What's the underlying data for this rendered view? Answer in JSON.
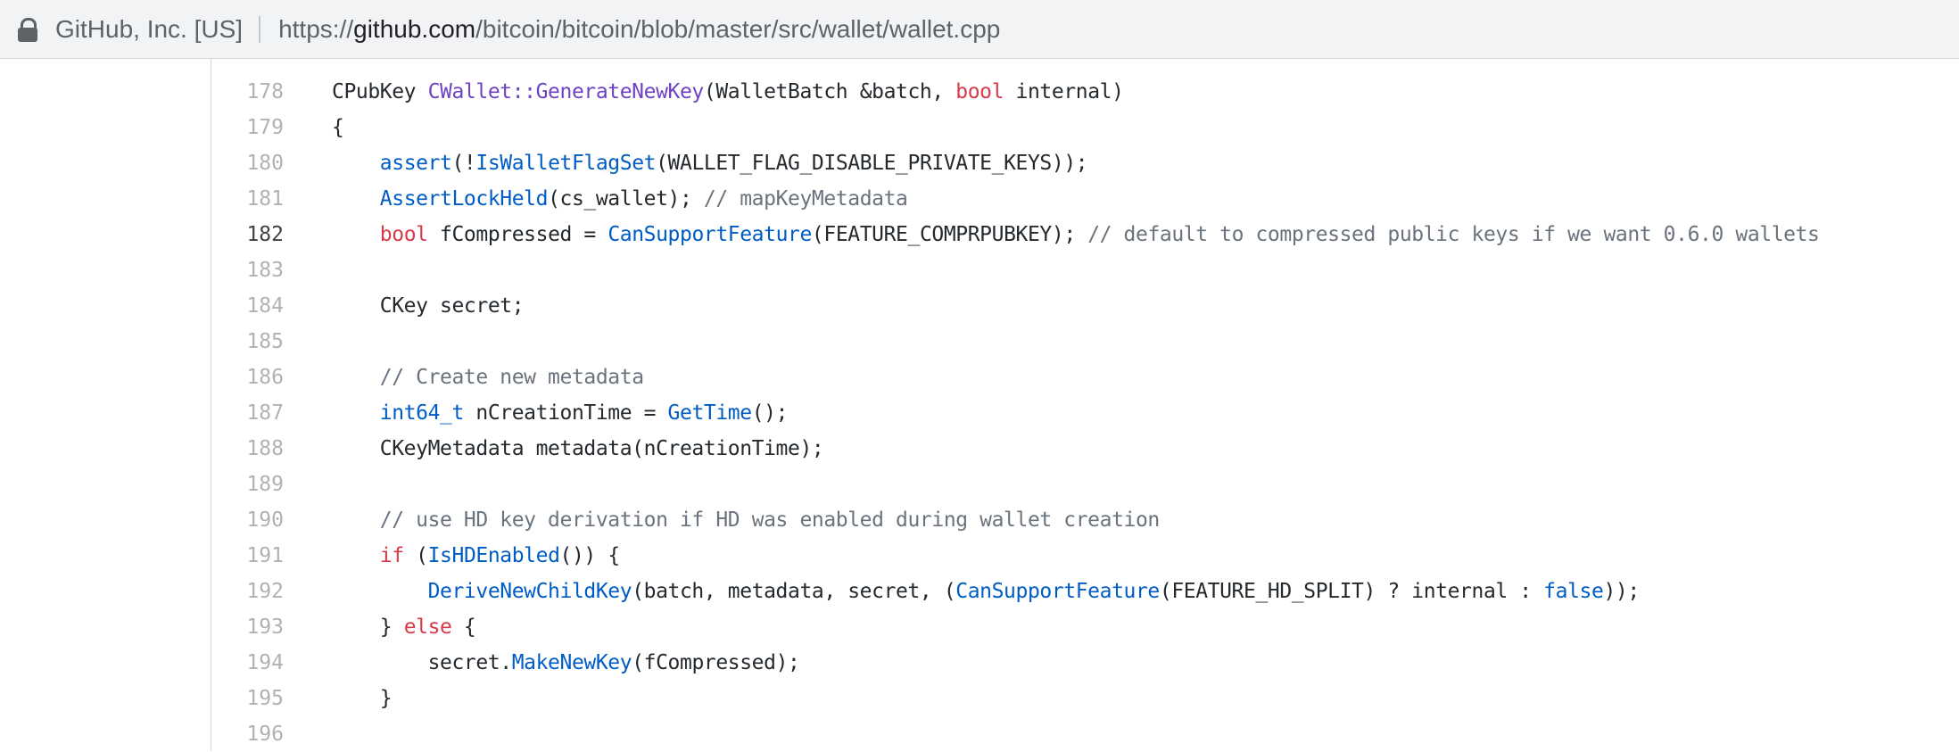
{
  "browser": {
    "site_identity": "GitHub, Inc. [US]",
    "url_scheme": "https://",
    "url_host": "github.com",
    "url_path": "/bitcoin/bitcoin/blob/master/src/wallet/wallet.cpp"
  },
  "code": {
    "highlighted_line": 182,
    "lines": [
      {
        "n": "178",
        "tokens": [
          {
            "t": "CPubKey ",
            "c": ""
          },
          {
            "t": "CWallet::GenerateNewKey",
            "c": "ent"
          },
          {
            "t": "(WalletBatch &batch, ",
            "c": ""
          },
          {
            "t": "bool",
            "c": "kw"
          },
          {
            "t": " internal)",
            "c": ""
          }
        ]
      },
      {
        "n": "179",
        "tokens": [
          {
            "t": "{",
            "c": ""
          }
        ]
      },
      {
        "n": "180",
        "tokens": [
          {
            "t": "    ",
            "c": ""
          },
          {
            "t": "assert",
            "c": "fn"
          },
          {
            "t": "(!",
            "c": ""
          },
          {
            "t": "IsWalletFlagSet",
            "c": "fn"
          },
          {
            "t": "(WALLET_FLAG_DISABLE_PRIVATE_KEYS));",
            "c": ""
          }
        ]
      },
      {
        "n": "181",
        "tokens": [
          {
            "t": "    ",
            "c": ""
          },
          {
            "t": "AssertLockHeld",
            "c": "fn"
          },
          {
            "t": "(cs_wallet); ",
            "c": ""
          },
          {
            "t": "// mapKeyMetadata",
            "c": "cm"
          }
        ]
      },
      {
        "n": "182",
        "tokens": [
          {
            "t": "    ",
            "c": ""
          },
          {
            "t": "bool",
            "c": "kw"
          },
          {
            "t": " fCompressed = ",
            "c": ""
          },
          {
            "t": "CanSupportFeature",
            "c": "fn"
          },
          {
            "t": "(FEATURE_COMPRPUBKEY); ",
            "c": ""
          },
          {
            "t": "// default to compressed public keys if we want 0.6.0 wallets",
            "c": "cm"
          }
        ]
      },
      {
        "n": "183",
        "tokens": []
      },
      {
        "n": "184",
        "tokens": [
          {
            "t": "    CKey secret;",
            "c": ""
          }
        ]
      },
      {
        "n": "185",
        "tokens": []
      },
      {
        "n": "186",
        "tokens": [
          {
            "t": "    ",
            "c": ""
          },
          {
            "t": "// Create new metadata",
            "c": "cm"
          }
        ]
      },
      {
        "n": "187",
        "tokens": [
          {
            "t": "    ",
            "c": ""
          },
          {
            "t": "int64_t",
            "c": "fn"
          },
          {
            "t": " nCreationTime = ",
            "c": ""
          },
          {
            "t": "GetTime",
            "c": "fn"
          },
          {
            "t": "();",
            "c": ""
          }
        ]
      },
      {
        "n": "188",
        "tokens": [
          {
            "t": "    CKeyMetadata metadata(nCreationTime);",
            "c": ""
          }
        ]
      },
      {
        "n": "189",
        "tokens": []
      },
      {
        "n": "190",
        "tokens": [
          {
            "t": "    ",
            "c": ""
          },
          {
            "t": "// use HD key derivation if HD was enabled during wallet creation",
            "c": "cm"
          }
        ]
      },
      {
        "n": "191",
        "tokens": [
          {
            "t": "    ",
            "c": ""
          },
          {
            "t": "if",
            "c": "kw"
          },
          {
            "t": " (",
            "c": ""
          },
          {
            "t": "IsHDEnabled",
            "c": "fn"
          },
          {
            "t": "()) {",
            "c": ""
          }
        ]
      },
      {
        "n": "192",
        "tokens": [
          {
            "t": "        ",
            "c": ""
          },
          {
            "t": "DeriveNewChildKey",
            "c": "fn"
          },
          {
            "t": "(batch, metadata, secret, (",
            "c": ""
          },
          {
            "t": "CanSupportFeature",
            "c": "fn"
          },
          {
            "t": "(FEATURE_HD_SPLIT) ? internal : ",
            "c": ""
          },
          {
            "t": "false",
            "c": "fn"
          },
          {
            "t": "));",
            "c": ""
          }
        ]
      },
      {
        "n": "193",
        "tokens": [
          {
            "t": "    } ",
            "c": ""
          },
          {
            "t": "else",
            "c": "kw"
          },
          {
            "t": " {",
            "c": ""
          }
        ]
      },
      {
        "n": "194",
        "tokens": [
          {
            "t": "        secret.",
            "c": ""
          },
          {
            "t": "MakeNewKey",
            "c": "fn"
          },
          {
            "t": "(fCompressed);",
            "c": ""
          }
        ]
      },
      {
        "n": "195",
        "tokens": [
          {
            "t": "    }",
            "c": ""
          }
        ]
      },
      {
        "n": "196",
        "tokens": []
      }
    ]
  }
}
